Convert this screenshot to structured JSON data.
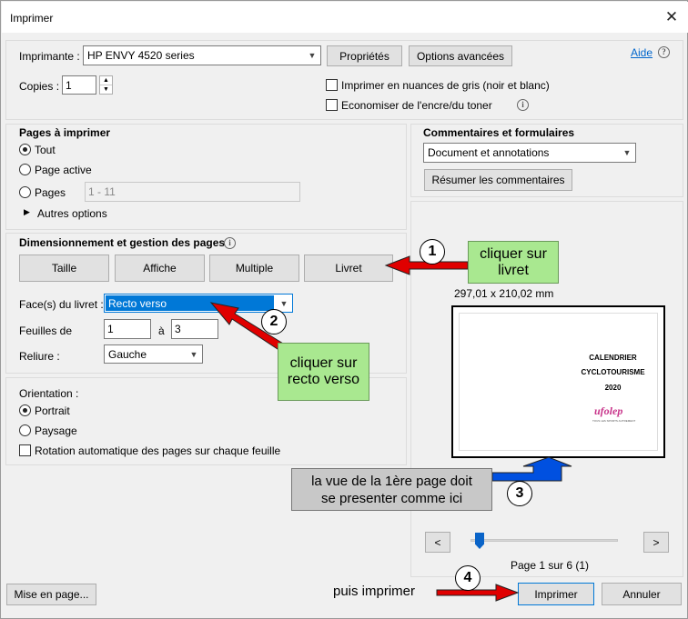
{
  "window": {
    "title": "Imprimer",
    "close": "✕"
  },
  "printer": {
    "label": "Imprimante :",
    "value": "HP ENVY 4520 series",
    "properties_label": "Propriétés",
    "advanced_label": "Options avancées",
    "help_label": "Aide",
    "copies_label": "Copies :",
    "copies_value": "1",
    "grayscale_label": "Imprimer en nuances de gris (noir et blanc)",
    "save_ink_label": "Economiser de l'encre/du toner"
  },
  "pages": {
    "title": "Pages à imprimer",
    "all_label": "Tout",
    "current_label": "Page active",
    "range_label": "Pages",
    "range_value": "1 - 11",
    "more_label": "Autres options"
  },
  "sizing": {
    "title": "Dimensionnement et gestion des pages",
    "tabs": [
      "Taille",
      "Affiche",
      "Multiple",
      "Livret"
    ],
    "sides_label": "Face(s) du livret :",
    "sides_value": "Recto verso",
    "sheets_label": "Feuilles de",
    "sheets_from": "1",
    "sheets_to_label": "à",
    "sheets_to": "3",
    "binding_label": "Reliure :",
    "binding_value": "Gauche"
  },
  "orientation": {
    "title": "Orientation :",
    "portrait_label": "Portrait",
    "landscape_label": "Paysage",
    "auto_rotate_label": "Rotation automatique des pages sur chaque feuille"
  },
  "comments": {
    "title": "Commentaires et formulaires",
    "value": "Document et annotations",
    "summarize_label": "Résumer les commentaires"
  },
  "preview": {
    "size_text": "297,01 x 210,02 mm",
    "line1": "CALENDRIER",
    "line2": "CYCLOTOURISME",
    "line3": "2020",
    "logo": "ufolep",
    "logo_sub": "TOUS LES SPORTS AUTREMENT",
    "page_text": "Page 1 sur 6 (1)",
    "prev_label": "<",
    "next_label": ">"
  },
  "footer": {
    "page_setup_label": "Mise en page...",
    "print_label": "Imprimer",
    "cancel_label": "Annuler"
  },
  "annotations": {
    "n1": "1",
    "n2": "2",
    "n3": "3",
    "n4": "4",
    "c1": "cliquer sur livret",
    "c2": "cliquer sur recto verso",
    "c3_line1": "la vue de la 1ère page doit",
    "c3_line2": "se presenter comme ici",
    "c4": "puis imprimer"
  },
  "colors": {
    "selected": "#0078d7",
    "callout_green": "#a9e890",
    "arrow_red": "#e00000",
    "arrow_blue": "#0050e0"
  }
}
